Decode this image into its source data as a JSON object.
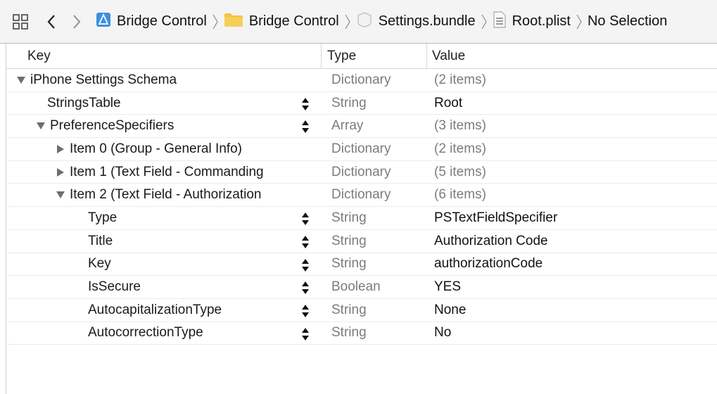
{
  "jumpbar": {
    "crumbs": [
      {
        "label": "Bridge Control",
        "icon": "app-icon"
      },
      {
        "label": "Bridge Control",
        "icon": "folder-icon"
      },
      {
        "label": "Settings.bundle",
        "icon": "bundle-icon"
      },
      {
        "label": "Root.plist",
        "icon": "plist-file-icon"
      },
      {
        "label": "No Selection",
        "icon": ""
      }
    ]
  },
  "table": {
    "headers": {
      "key": "Key",
      "type": "Type",
      "value": "Value"
    },
    "rows": [
      {
        "key": "iPhone Settings Schema",
        "type": "Dictionary",
        "value": "(2 items)",
        "depth": 0,
        "disclosure": "expanded",
        "stepper": false,
        "value_muted": true
      },
      {
        "key": "StringsTable",
        "type": "String",
        "value": "Root",
        "depth": 1,
        "disclosure": "none",
        "stepper": true,
        "value_muted": false
      },
      {
        "key": "PreferenceSpecifiers",
        "type": "Array",
        "value": "(3 items)",
        "depth": 1,
        "disclosure": "expanded",
        "stepper": true,
        "value_muted": true
      },
      {
        "key": "Item 0 (Group - General Info)",
        "type": "Dictionary",
        "value": "(2 items)",
        "depth": 2,
        "disclosure": "collapsed",
        "stepper": false,
        "value_muted": true
      },
      {
        "key": "Item 1 (Text Field - Commanding",
        "type": "Dictionary",
        "value": "(5 items)",
        "depth": 2,
        "disclosure": "collapsed",
        "stepper": false,
        "value_muted": true
      },
      {
        "key": "Item 2 (Text Field - Authorization",
        "type": "Dictionary",
        "value": "(6 items)",
        "depth": 2,
        "disclosure": "expanded",
        "stepper": false,
        "value_muted": true
      },
      {
        "key": "Type",
        "type": "String",
        "value": "PSTextFieldSpecifier",
        "depth": 3,
        "disclosure": "none",
        "stepper": true,
        "value_muted": false
      },
      {
        "key": "Title",
        "type": "String",
        "value": "Authorization Code",
        "depth": 3,
        "disclosure": "none",
        "stepper": true,
        "value_muted": false
      },
      {
        "key": "Key",
        "type": "String",
        "value": "authorizationCode",
        "depth": 3,
        "disclosure": "none",
        "stepper": true,
        "value_muted": false
      },
      {
        "key": "IsSecure",
        "type": "Boolean",
        "value": "YES",
        "depth": 3,
        "disclosure": "none",
        "stepper": true,
        "value_muted": false
      },
      {
        "key": "AutocapitalizationType",
        "type": "String",
        "value": "None",
        "depth": 3,
        "disclosure": "none",
        "stepper": true,
        "value_muted": false
      },
      {
        "key": "AutocorrectionType",
        "type": "String",
        "value": "No",
        "depth": 3,
        "disclosure": "none",
        "stepper": true,
        "value_muted": false
      }
    ]
  },
  "colors": {
    "accent_folder": "#f5c242",
    "app_icon": "#3d8fe0",
    "muted_text": "#7c7c7c"
  }
}
